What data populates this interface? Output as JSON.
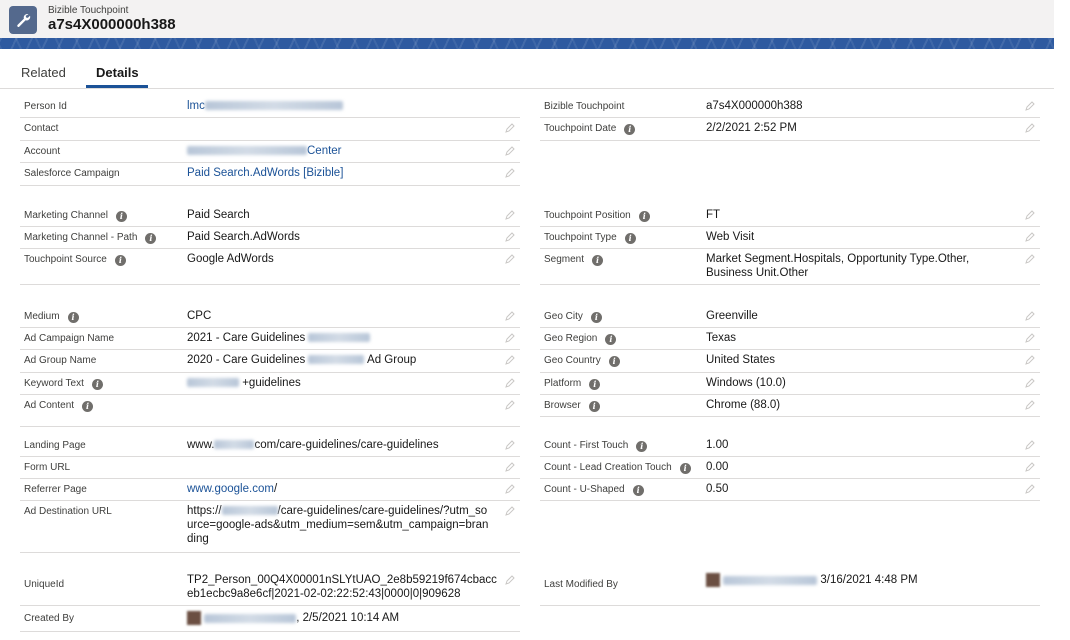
{
  "header": {
    "object_label": "Bizible Touchpoint",
    "record_name": "a7s4X000000h388"
  },
  "tabs": [
    {
      "label": "Related"
    },
    {
      "label": "Details"
    }
  ],
  "left_fields": {
    "person_id": {
      "label": "Person Id",
      "value": "lmc"
    },
    "contact": {
      "label": "Contact",
      "value": ""
    },
    "account": {
      "label": "Account",
      "value": "Center"
    },
    "salesforce_campaign": {
      "label": "Salesforce Campaign",
      "value": "Paid Search.AdWords [Bizible]"
    },
    "marketing_channel": {
      "label": "Marketing Channel",
      "value": "Paid Search"
    },
    "marketing_channel_path": {
      "label": "Marketing Channel - Path",
      "value": "Paid Search.AdWords"
    },
    "touchpoint_source": {
      "label": "Touchpoint Source",
      "value": "Google AdWords"
    },
    "medium": {
      "label": "Medium",
      "value": "CPC"
    },
    "ad_campaign_name": {
      "label": "Ad Campaign Name",
      "value": "2021 - Care Guidelines"
    },
    "ad_group_name": {
      "label": "Ad Group Name",
      "value": "2020 - Care Guidelines",
      "value_suffix": "Ad Group"
    },
    "keyword_text": {
      "label": "Keyword Text",
      "value": "+guidelines"
    },
    "ad_content": {
      "label": "Ad Content",
      "value": ""
    },
    "landing_page": {
      "label": "Landing Page",
      "value_prefix": "www.",
      "value": "com/care-guidelines/care-guidelines"
    },
    "form_url": {
      "label": "Form URL",
      "value": ""
    },
    "referrer_page": {
      "label": "Referrer Page",
      "value": "www.google.com",
      "value_suffix": "/"
    },
    "ad_destination_url": {
      "label": "Ad Destination URL",
      "value_prefix": "https://",
      "value": "/care-guidelines/care-guidelines/?utm_source=google-ads&utm_medium=sem&utm_campaign=branding"
    },
    "unique_id": {
      "label": "UniqueId",
      "value": "TP2_Person_00Q4X00001nSLYtUAO_2e8b59219f674cbacceb1ecbc9a8e6cf|2021-02-02:22:52:43|0000|0|909628"
    },
    "created_by": {
      "label": "Created By",
      "value": ", 2/5/2021 10:14 AM"
    }
  },
  "right_fields": {
    "bizible_touchpoint": {
      "label": "Bizible Touchpoint",
      "value": "a7s4X000000h388"
    },
    "touchpoint_date": {
      "label": "Touchpoint Date",
      "value": "2/2/2021 2:52 PM"
    },
    "touchpoint_position": {
      "label": "Touchpoint Position",
      "value": "FT"
    },
    "touchpoint_type": {
      "label": "Touchpoint Type",
      "value": "Web Visit"
    },
    "segment": {
      "label": "Segment",
      "value": "Market Segment.Hospitals, Opportunity Type.Other, Business Unit.Other"
    },
    "geo_city": {
      "label": "Geo City",
      "value": "Greenville"
    },
    "geo_region": {
      "label": "Geo Region",
      "value": "Texas"
    },
    "geo_country": {
      "label": "Geo Country",
      "value": "United States"
    },
    "platform": {
      "label": "Platform",
      "value": "Windows (10.0)"
    },
    "browser": {
      "label": "Browser",
      "value": "Chrome (88.0)"
    },
    "count_first_touch": {
      "label": "Count - First Touch",
      "value": "1.00"
    },
    "count_lead_creation_touch": {
      "label": "Count - Lead Creation Touch",
      "value": "0.00"
    },
    "count_u_shaped": {
      "label": "Count - U-Shaped",
      "value": "0.50"
    },
    "last_modified_by": {
      "label": "Last Modified By",
      "value": "3/16/2021 4:48 PM"
    }
  },
  "icons": {
    "app": "wrench-icon",
    "info": "info-icon",
    "edit": "pencil-icon"
  },
  "colors": {
    "link": "#1b5297",
    "band": "#2e5aa0",
    "app_icon": "#54698d"
  }
}
